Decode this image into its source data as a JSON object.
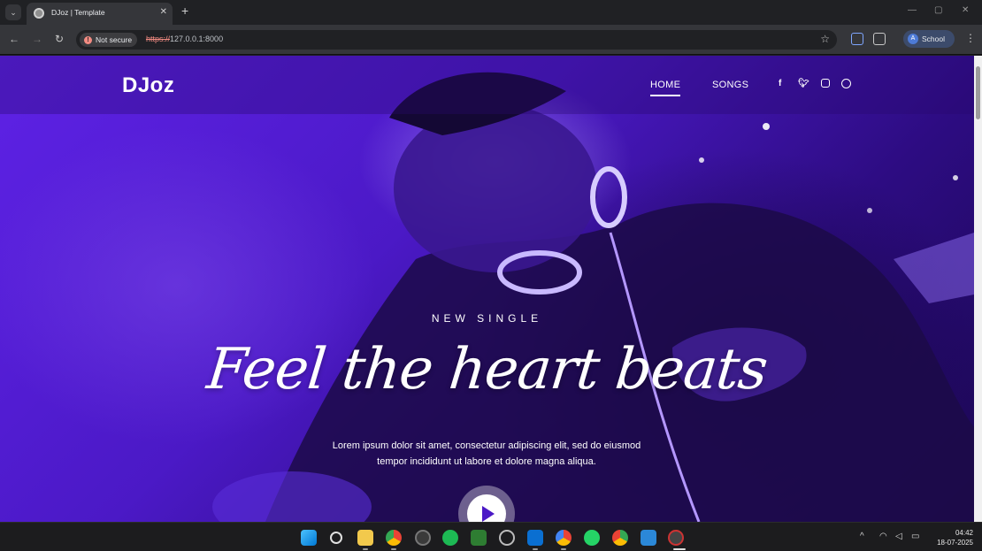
{
  "browser": {
    "tab_title": "DJoz | Template",
    "tab_close": "✕",
    "new_tab": "+",
    "security_label": "Not secure",
    "url_scheme": "https://",
    "url_rest": "127.0.0.1:8000",
    "profile_initial": "A",
    "profile_name": "School"
  },
  "site": {
    "brand": "DJoz",
    "menu": [
      "HOME",
      "SONGS"
    ],
    "social_icons": [
      "facebook-icon",
      "twitter-icon",
      "instagram-icon",
      "dribbble-icon"
    ]
  },
  "hero": {
    "eyebrow": "NEW SINGLE",
    "title": "Feel the heart beats",
    "text_line1": "Lorem ipsum dolor sit amet, consectetur adipiscing elit, sed do eiusmod",
    "text_line2": "tempor incididunt ut labore et dolore magna aliqua."
  },
  "taskbar": {
    "time": "04:42",
    "date": "18-07-2025"
  },
  "colors": {
    "accent": "#5e22e6",
    "deep": "#2d0c82"
  }
}
